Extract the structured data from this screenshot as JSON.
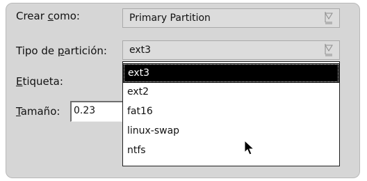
{
  "form": {
    "crear_como": {
      "label_pre": "Crear ",
      "label_ul": "c",
      "label_post": "omo:",
      "value": "Primary Partition",
      "arrow_icon": "combo-arrow-icon"
    },
    "tipo_particion": {
      "label_pre": "Tipo de ",
      "label_ul": "p",
      "label_post": "artición:",
      "value": "ext3",
      "arrow_icon": "combo-arrow-icon"
    },
    "etiqueta": {
      "label_ul": "E",
      "label_post": "tiqueta:"
    },
    "tamano": {
      "label_ul": "T",
      "label_post": "amaño:",
      "value": "0.23"
    }
  },
  "dropdown": {
    "selected_index": 0,
    "options": [
      "ext3",
      "ext2",
      "fat16",
      "linux-swap",
      "ntfs"
    ]
  },
  "cursor": "arrow-pointer-icon",
  "colors": {
    "dialog_bg": "#d6d6d6",
    "selected_bg": "#000000",
    "selected_fg": "#ffffff",
    "popup_bg": "#ffffff"
  }
}
